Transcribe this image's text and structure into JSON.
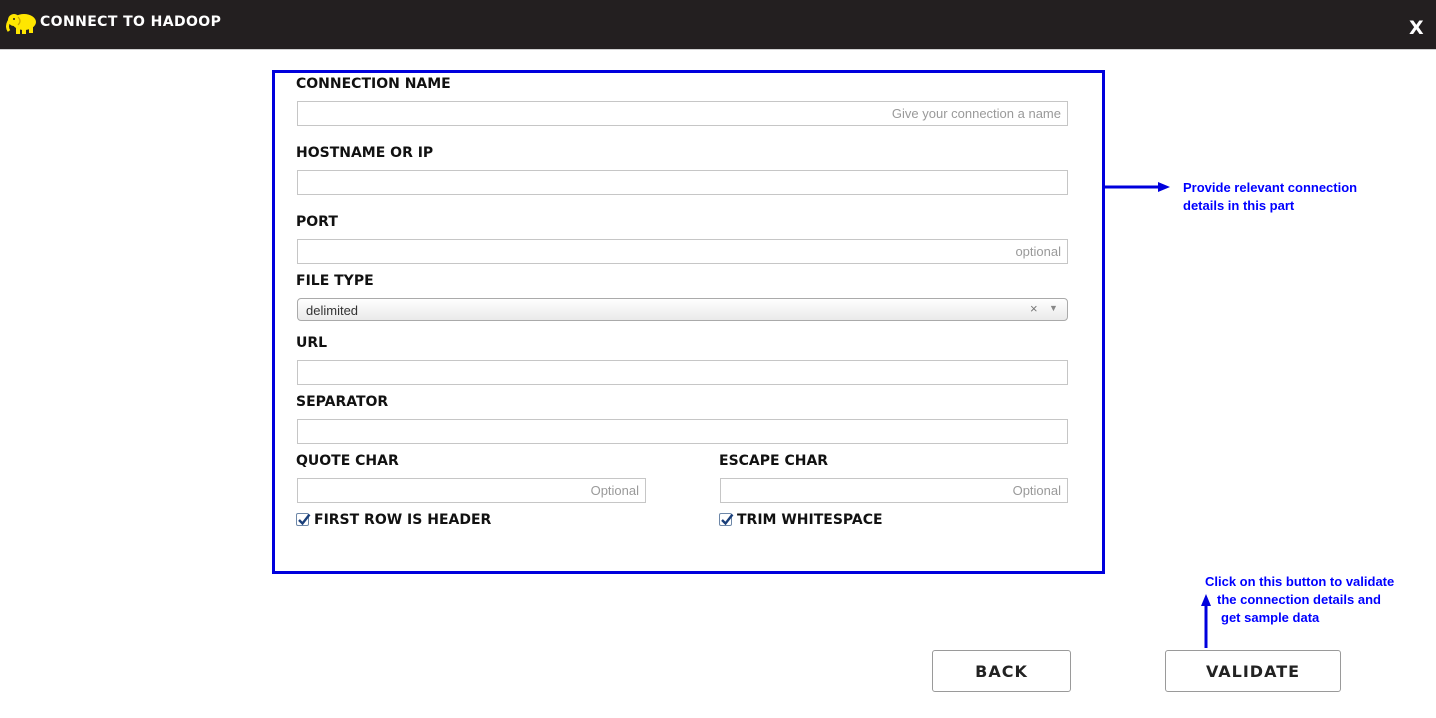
{
  "window": {
    "title": "CONNECT TO HADOOP",
    "close_label": "X",
    "logo_icon": "hadoop-elephant-icon"
  },
  "form": {
    "connection_name": {
      "label": "CONNECTION NAME",
      "value": "",
      "placeholder": "Give your connection a name"
    },
    "hostname": {
      "label": "HOSTNAME OR IP",
      "value": "",
      "placeholder": ""
    },
    "port": {
      "label": "PORT",
      "value": "",
      "placeholder": "optional"
    },
    "file_type": {
      "label": "FILE TYPE",
      "value": "delimited",
      "clear_label": "×"
    },
    "url": {
      "label": "URL",
      "value": "",
      "placeholder": ""
    },
    "separator": {
      "label": "SEPARATOR",
      "value": "",
      "placeholder": ""
    },
    "quote_char": {
      "label": "QUOTE CHAR",
      "value": "",
      "placeholder": "Optional"
    },
    "escape_char": {
      "label": "ESCAPE CHAR",
      "value": "",
      "placeholder": "Optional"
    },
    "first_row_header": {
      "label": "FIRST ROW IS HEADER",
      "checked": true
    },
    "trim_whitespace": {
      "label": "TRIM WHITESPACE",
      "checked": true
    }
  },
  "buttons": {
    "back": "BACK",
    "validate": "VALIDATE"
  },
  "annotations": {
    "form_note": [
      "Provide relevant connection",
      "details in this part"
    ],
    "validate_note": [
      "Click on this button to validate",
      "the connection details and",
      "get sample data"
    ]
  },
  "colors": {
    "titlebar": "#231f20",
    "logo": "#ffe600",
    "annotation": "#0000ff",
    "highlight_border": "#0000dd",
    "checkbox_check": "#1a3f7a"
  }
}
